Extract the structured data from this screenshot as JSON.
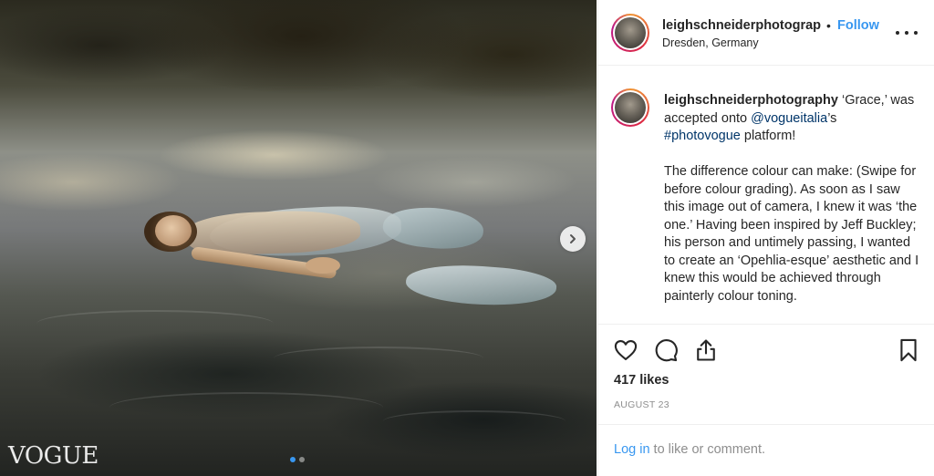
{
  "photo": {
    "watermark": "VOGUE",
    "carousel": {
      "current": 1,
      "total": 2
    }
  },
  "header": {
    "username": "leighschneiderphotograp",
    "bullet": "•",
    "follow_label": "Follow",
    "location": "Dresden, Germany"
  },
  "caption": {
    "username": "leighschneiderphotography",
    "text_1": " ‘Grace,’ was accepted onto ",
    "mention": "@vogueitalia",
    "text_2": "’s ",
    "hashtag": "#photovogue",
    "text_3": " platform!",
    "paragraph_2": "The difference colour can make: (Swipe for before colour grading). As soon as I saw this image out of camera, I knew it was ‘the one.’ Having been inspired by Jeff Buckley; his person and untimely passing, I wanted to create an ‘Opehlia-esque’ aesthetic and I knew this would be achieved through painterly colour toning."
  },
  "stats": {
    "likes": "417 likes",
    "date": "AUGUST 23"
  },
  "login": {
    "link_label": "Log in",
    "text": " to like or comment."
  },
  "icons": {
    "like": "heart-icon",
    "comment": "comment-icon",
    "share": "share-icon",
    "save": "bookmark-icon",
    "next": "chevron-right-icon",
    "more": "more-dots-icon"
  },
  "colors": {
    "accent": "#3897f0",
    "link": "#003569",
    "muted": "#8e8e8e"
  }
}
